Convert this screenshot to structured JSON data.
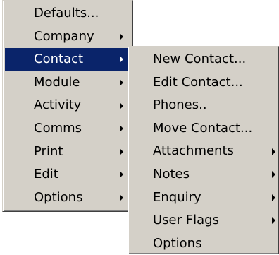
{
  "colors": {
    "menu_bg": "#d4d0c8",
    "selected_bg": "#0a246a",
    "selected_text": "#ffffff",
    "text": "#000000"
  },
  "main_menu": {
    "items": [
      {
        "label": "Defaults...",
        "has_submenu": false,
        "selected": false
      },
      {
        "label": "Company",
        "has_submenu": true,
        "selected": false
      },
      {
        "label": "Contact",
        "has_submenu": true,
        "selected": true
      },
      {
        "label": "Module",
        "has_submenu": true,
        "selected": false
      },
      {
        "label": "Activity",
        "has_submenu": true,
        "selected": false
      },
      {
        "label": "Comms",
        "has_submenu": true,
        "selected": false
      },
      {
        "label": "Print",
        "has_submenu": true,
        "selected": false
      },
      {
        "label": "Edit",
        "has_submenu": true,
        "selected": false
      },
      {
        "label": "Options",
        "has_submenu": true,
        "selected": false
      }
    ]
  },
  "contact_submenu": {
    "items": [
      {
        "label": "New Contact...",
        "has_submenu": false
      },
      {
        "label": "Edit Contact...",
        "has_submenu": false
      },
      {
        "label": "Phones..",
        "has_submenu": false
      },
      {
        "label": "Move Contact...",
        "has_submenu": false
      },
      {
        "label": "Attachments",
        "has_submenu": true
      },
      {
        "label": "Notes",
        "has_submenu": true
      },
      {
        "label": "Enquiry",
        "has_submenu": true
      },
      {
        "label": "User Flags",
        "has_submenu": true
      },
      {
        "label": "Options",
        "has_submenu": false
      }
    ]
  }
}
